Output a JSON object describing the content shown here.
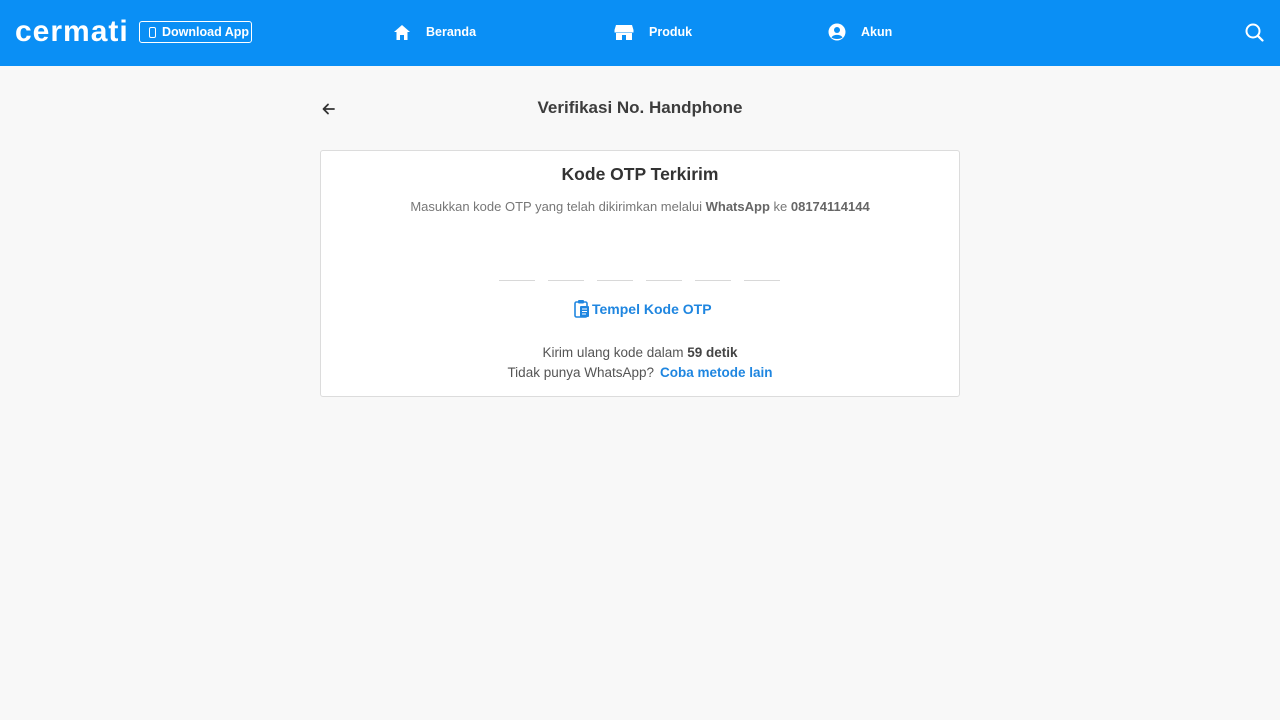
{
  "header": {
    "logo_text": "cermati",
    "download_label": "Download App",
    "nav": [
      {
        "label": "Beranda",
        "icon": "home-icon"
      },
      {
        "label": "Produk",
        "icon": "store-icon"
      },
      {
        "label": "Akun",
        "icon": "account-icon"
      }
    ],
    "search_icon": "search-icon",
    "bg_color": "#0a8ff5"
  },
  "page": {
    "title": "Verifikasi No. Handphone",
    "back_icon": "arrow-left-icon"
  },
  "card": {
    "title": "Kode OTP Terkirim",
    "desc_prefix": "Masukkan kode OTP yang telah dikirimkan melalui ",
    "desc_channel": "WhatsApp",
    "desc_mid": " ke ",
    "desc_phone": "08174114144",
    "otp_digits": [
      "",
      "",
      "",
      "",
      "",
      ""
    ],
    "paste_label": "Tempel Kode OTP",
    "paste_icon": "clipboard-icon",
    "resend_prefix": "Kirim ulang kode dalam ",
    "resend_timer": "59 detik",
    "alt_question": "Tidak punya WhatsApp?",
    "alt_link": "Coba metode lain",
    "link_color": "#1f86e0"
  }
}
